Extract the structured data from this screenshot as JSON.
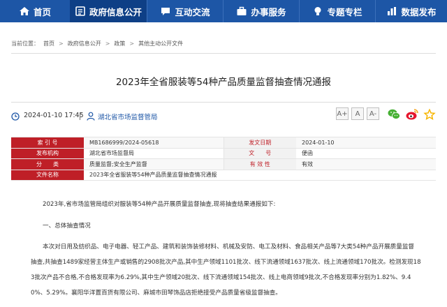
{
  "nav": {
    "items": [
      {
        "label": "首页",
        "icon": "home-icon"
      },
      {
        "label": "政府信息公开",
        "icon": "document-list-icon"
      },
      {
        "label": "互动交流",
        "icon": "chat-icon"
      },
      {
        "label": "办事服务",
        "icon": "briefcase-icon"
      },
      {
        "label": "专题专栏",
        "icon": "lightbulb-icon"
      },
      {
        "label": "数据发布",
        "icon": "bar-chart-icon"
      }
    ],
    "colors": {
      "bar": "#1d56a6",
      "active": "#0e3f86"
    }
  },
  "breadcrumb": {
    "label": "当前位置：",
    "items": [
      "首页",
      "政府信息公开",
      "政策",
      "其他主动公开文件"
    ],
    "separator": ">"
  },
  "article": {
    "title": "2023年全省服装等54种产品质量监督抽查情况通报",
    "date": "2024-01-10 17:45",
    "source": "湖北省市场监督管局",
    "font_buttons": [
      "A+",
      "A",
      "A-"
    ],
    "share_icons": [
      "wechat-icon",
      "weibo-icon",
      "favorite-star-icon"
    ]
  },
  "info_table": {
    "rows": [
      {
        "k1": "索 引 号",
        "v1": "MB1686999/2024-05618",
        "k2": "发文日期",
        "v2": "2024-01-10"
      },
      {
        "k1": "发布机构",
        "v1": "湖北省市场监督局",
        "k2": "文　　号",
        "v2": "便函"
      },
      {
        "k1": "分　　类",
        "v1": "质量监督;安全生产监督",
        "k2": "有 效 性",
        "v2": "有效"
      },
      {
        "k1": "文件名称",
        "v1": "2023年全省服装等54种产品质量监督抽查情况通报"
      }
    ],
    "colors": {
      "key_bg": "#bf1f27"
    }
  },
  "body": {
    "intro": "2023年,省市场监管局组织对服装等54种产品开展质量监督抽查,现将抽查结果通报如下:",
    "section1": "一、总体抽查情况",
    "para_lines": [
      "本次对日用及纺织品、电子电器、轻工产品、建筑和装饰装修材料、机械及安防、电工及材料、食品相关产品等7大类54种产品开展质量监督",
      "抽查,共抽查1489家经营主体生产或销售的2908批次产品,其中生产领域1101批次、线下流通领域1637批次、线上流通领域170批次。检测发现18",
      "3批次产品不合格,不合格发现率为6.29%,其中生产领域20批次、线下流通领域154批次、线上电商领域9批次,不合格发现率分别为1.82%、9.4",
      "0%、5.29%。襄阳华洋置百货有限公司、麻城市田琴饰品店拒绝接受产品质量省级监督抽查。"
    ]
  }
}
